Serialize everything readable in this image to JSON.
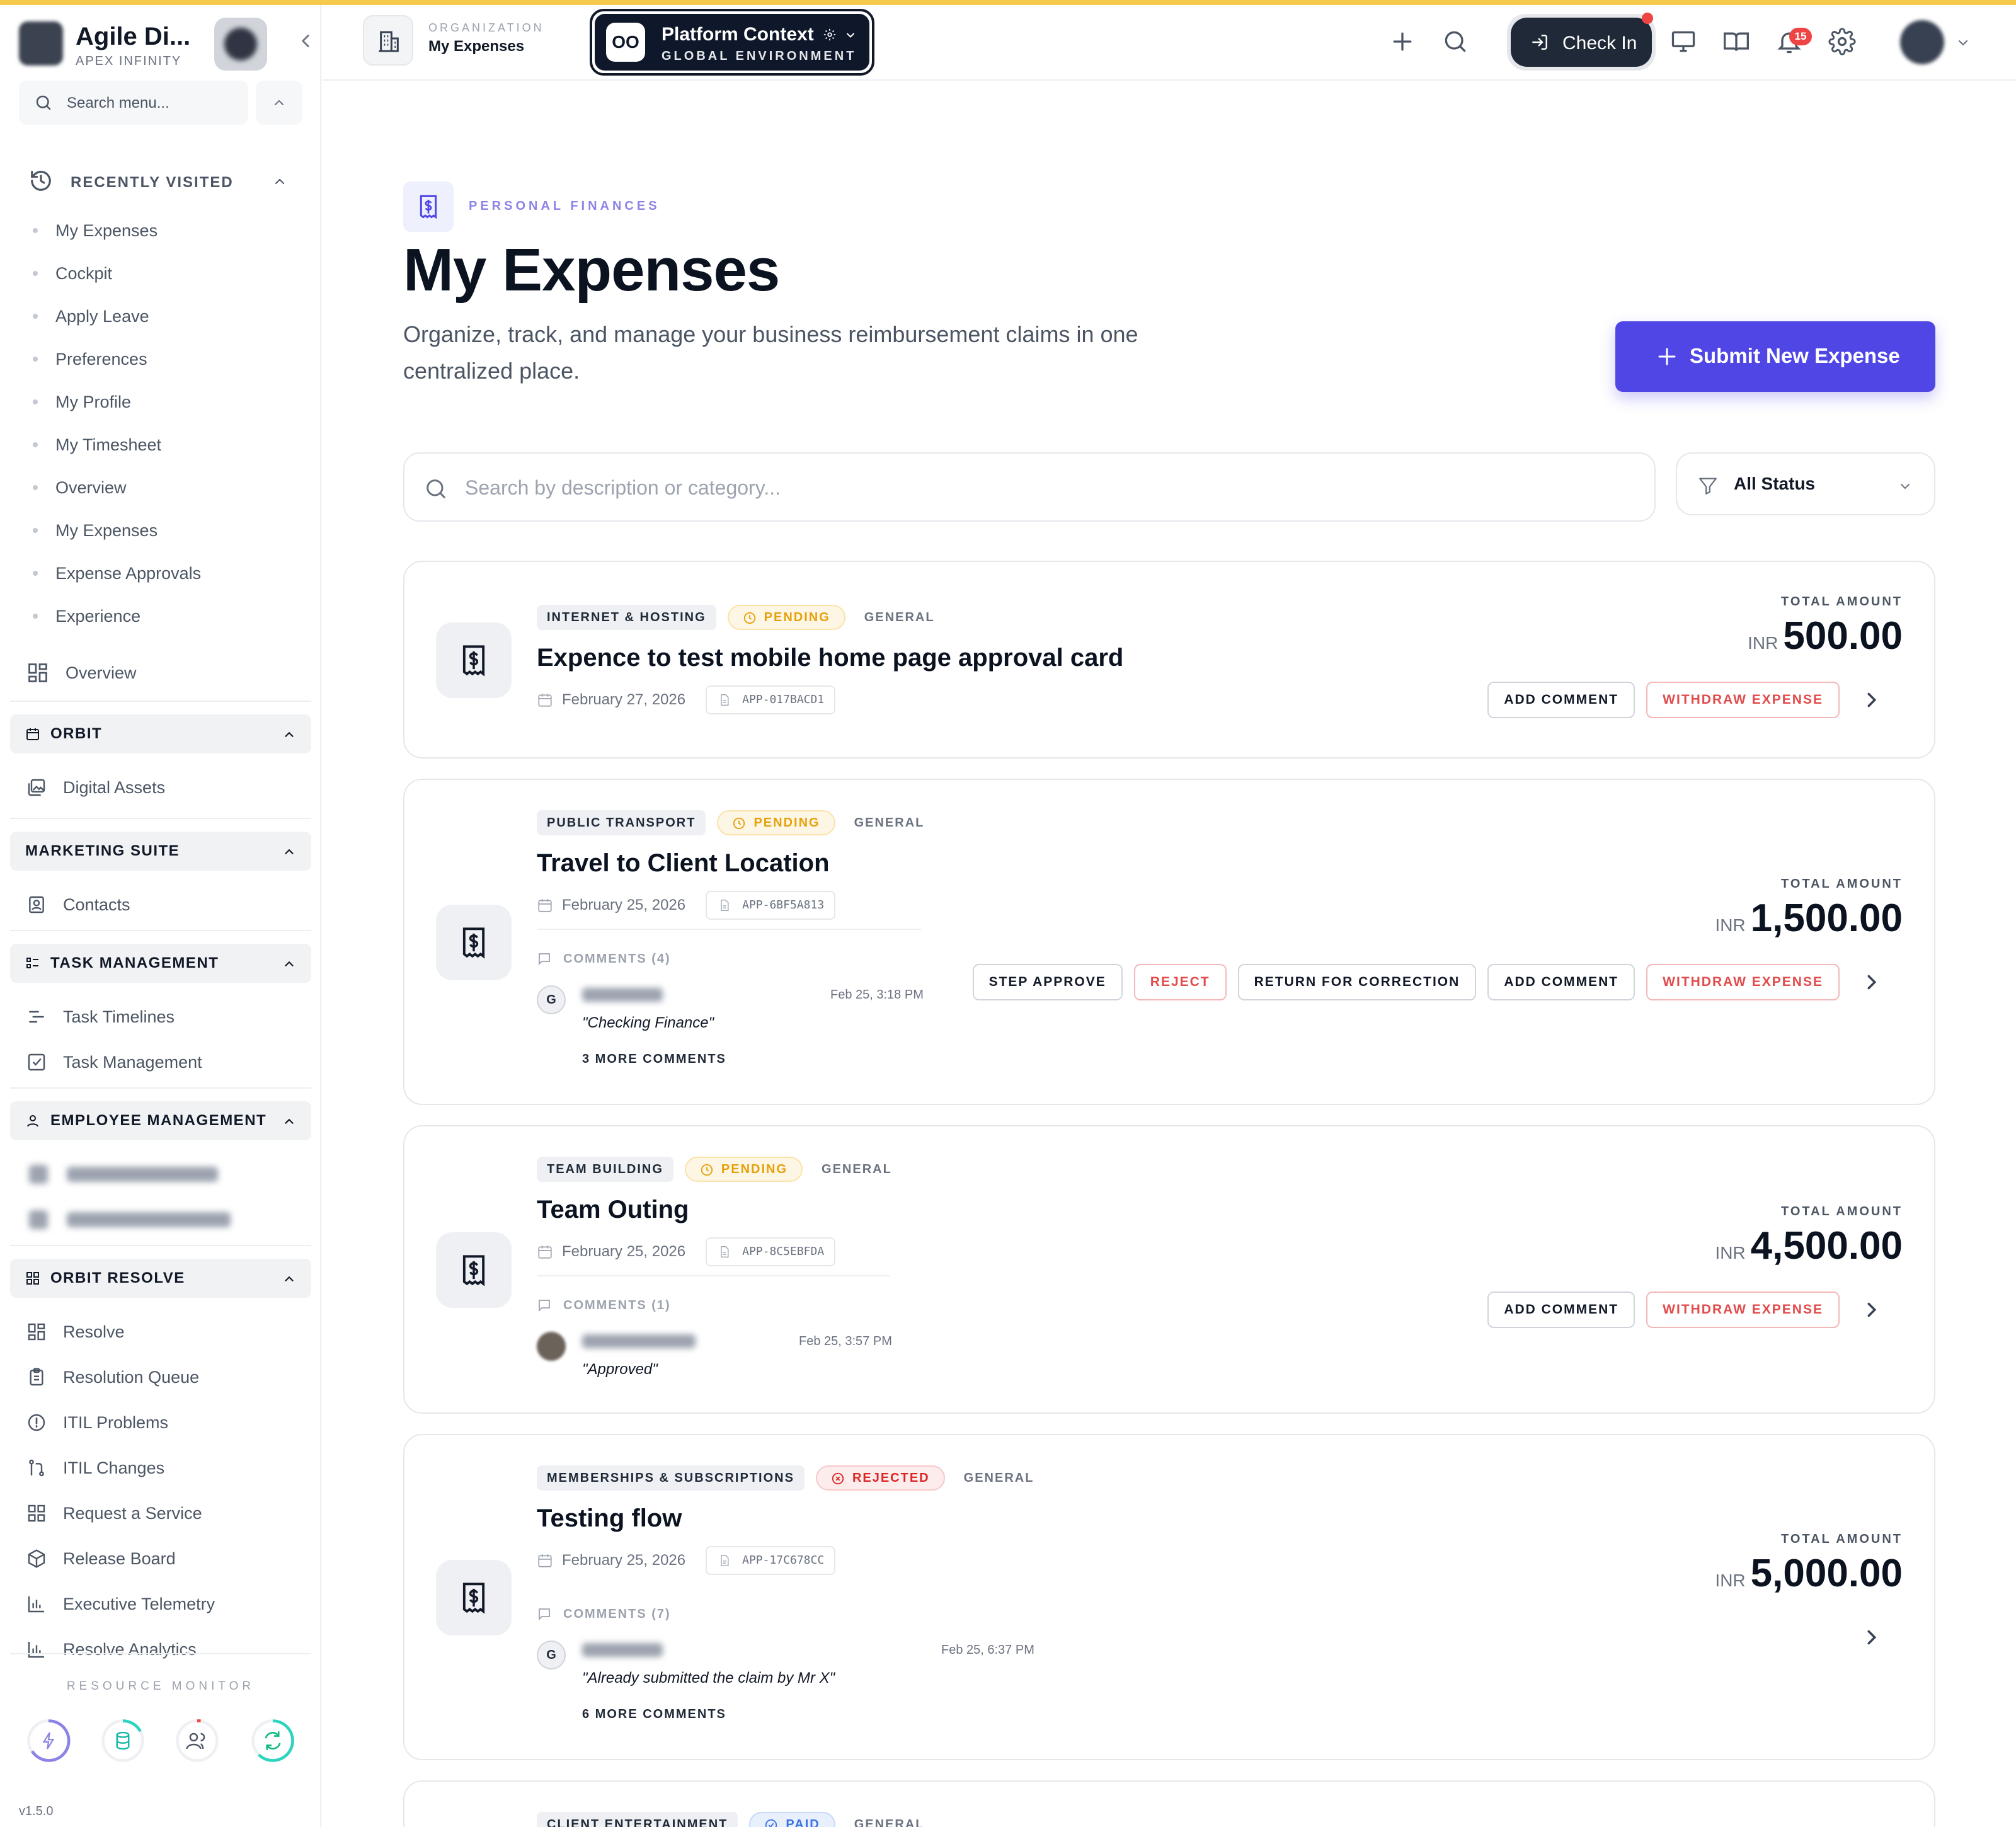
{
  "brand": {
    "name": "Agile Di...",
    "subtitle": "APEX INFINITY"
  },
  "sidebar": {
    "search_placeholder": "Search menu...",
    "recently_visited": {
      "title": "RECENTLY VISITED",
      "items": [
        "My Expenses",
        "Cockpit",
        "Apply Leave",
        "Preferences",
        "My Profile",
        "My Timesheet",
        "Overview",
        "My Expenses",
        "Expense Approvals",
        "Experience"
      ]
    },
    "overview_label": "Overview",
    "sections": {
      "orbit": {
        "title": "ORBIT",
        "items": [
          "Digital Assets"
        ]
      },
      "marketing": {
        "title": "MARKETING SUITE",
        "items": [
          "Contacts"
        ]
      },
      "task": {
        "title": "TASK MANAGEMENT",
        "items": [
          "Task Timelines",
          "Task Management"
        ]
      },
      "employee": {
        "title": "EMPLOYEE MANAGEMENT"
      },
      "resolve": {
        "title": "ORBIT RESOLVE",
        "items": [
          "Resolve",
          "Resolution Queue",
          "ITIL Problems",
          "ITIL Changes",
          "Request a Service",
          "Release Board",
          "Executive Telemetry",
          "Resolve Analytics"
        ]
      }
    },
    "resource_monitor_label": "RESOURCE MONITOR",
    "version": "v1.5.0"
  },
  "topbar": {
    "org_label": "ORGANIZATION",
    "org_value": "My Expenses",
    "context_logo": "OO",
    "context_title": "Platform Context",
    "context_subtitle": "GLOBAL ENVIRONMENT",
    "checkin_label": "Check In",
    "notification_count": "15",
    "accent_color": "#4f46e5"
  },
  "page": {
    "eyebrow": "PERSONAL FINANCES",
    "title": "My Expenses",
    "description": "Organize, track, and manage your business reimbursement claims in one centralized place.",
    "submit_label": "Submit New Expense",
    "search_placeholder": "Search by description or category...",
    "status_filter": "All Status"
  },
  "expenses": [
    {
      "category": "INTERNET & HOSTING",
      "status": "PENDING",
      "type": "GENERAL",
      "title": "Expence to test mobile home page approval card",
      "date": "February 27, 2026",
      "app_id": "APP-017BACD1",
      "amount_label": "TOTAL AMOUNT",
      "currency": "INR",
      "amount": "500.00",
      "actions": [
        "ADD COMMENT",
        "WITHDRAW EXPENSE"
      ]
    },
    {
      "category": "PUBLIC TRANSPORT",
      "status": "PENDING",
      "type": "GENERAL",
      "title": "Travel to Client Location",
      "date": "February 25, 2026",
      "app_id": "APP-6BF5A813",
      "comments_label": "COMMENTS (4)",
      "comment": {
        "initial": "G",
        "time": "Feb 25, 3:18 PM",
        "text": "\"Checking Finance\""
      },
      "more_label": "3 MORE COMMENTS",
      "amount_label": "TOTAL AMOUNT",
      "currency": "INR",
      "amount": "1,500.00",
      "actions": [
        "STEP APPROVE",
        "REJECT",
        "RETURN FOR CORRECTION",
        "ADD COMMENT",
        "WITHDRAW EXPENSE"
      ]
    },
    {
      "category": "TEAM BUILDING",
      "status": "PENDING",
      "type": "GENERAL",
      "title": "Team Outing",
      "date": "February 25, 2026",
      "app_id": "APP-8C5EBFDA",
      "comments_label": "COMMENTS (1)",
      "comment": {
        "time": "Feb 25, 3:57 PM",
        "text": "\"Approved\""
      },
      "amount_label": "TOTAL AMOUNT",
      "currency": "INR",
      "amount": "4,500.00",
      "actions": [
        "ADD COMMENT",
        "WITHDRAW EXPENSE"
      ]
    },
    {
      "category": "MEMBERSHIPS & SUBSCRIPTIONS",
      "status": "REJECTED",
      "type": "GENERAL",
      "title": "Testing flow",
      "date": "February 25, 2026",
      "app_id": "APP-17C678CC",
      "comments_label": "COMMENTS (7)",
      "comment": {
        "initial": "G",
        "time": "Feb 25, 6:37 PM",
        "text": "\"Already submitted the claim by Mr X\""
      },
      "more_label": "6 MORE COMMENTS",
      "amount_label": "TOTAL AMOUNT",
      "currency": "INR",
      "amount": "5,000.00"
    },
    {
      "category": "CLIENT ENTERTAINMENT",
      "status": "PAID",
      "type": "GENERAL"
    }
  ]
}
